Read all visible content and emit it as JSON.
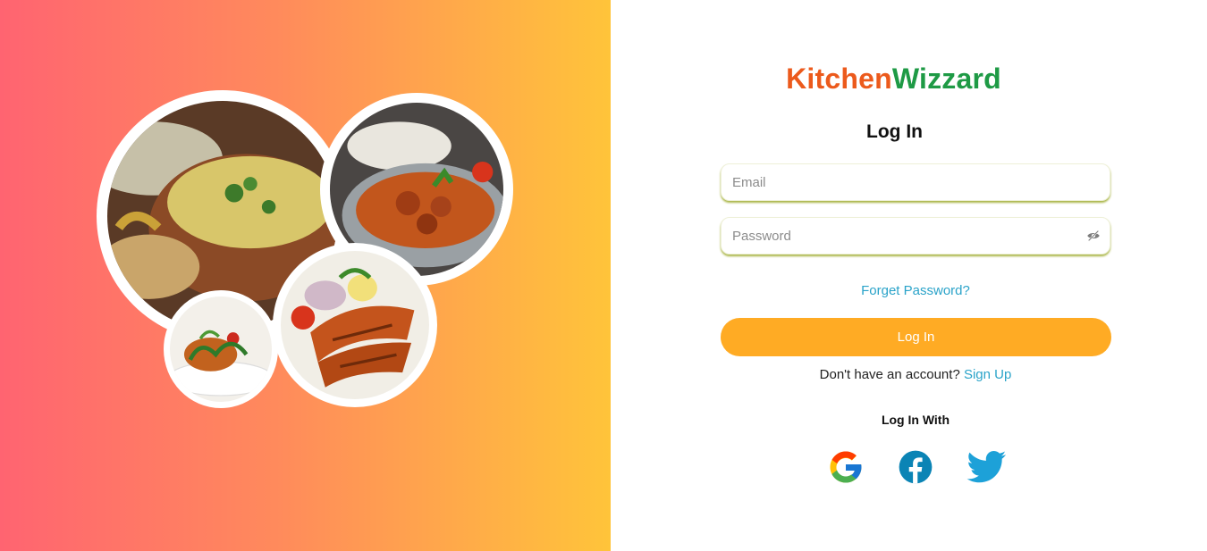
{
  "brand": {
    "part1": "Kitchen",
    "part2": "Wizzard"
  },
  "login": {
    "heading": "Log In",
    "email_placeholder": "Email",
    "password_placeholder": "Password",
    "forgot_label": "Forget Password?",
    "submit_label": "Log In",
    "signup_prompt": "Don't have an account?",
    "signup_link": "Sign Up",
    "social_heading": "Log In With"
  },
  "social": [
    "google-icon",
    "facebook-icon",
    "twitter-icon"
  ],
  "colors": {
    "brand_primary": "#ec5a1c",
    "brand_secondary": "#1e9a45",
    "button": "#ffab24",
    "link": "#2aa3c9",
    "facebook": "#0b84b5",
    "twitter": "#1da1d8"
  }
}
